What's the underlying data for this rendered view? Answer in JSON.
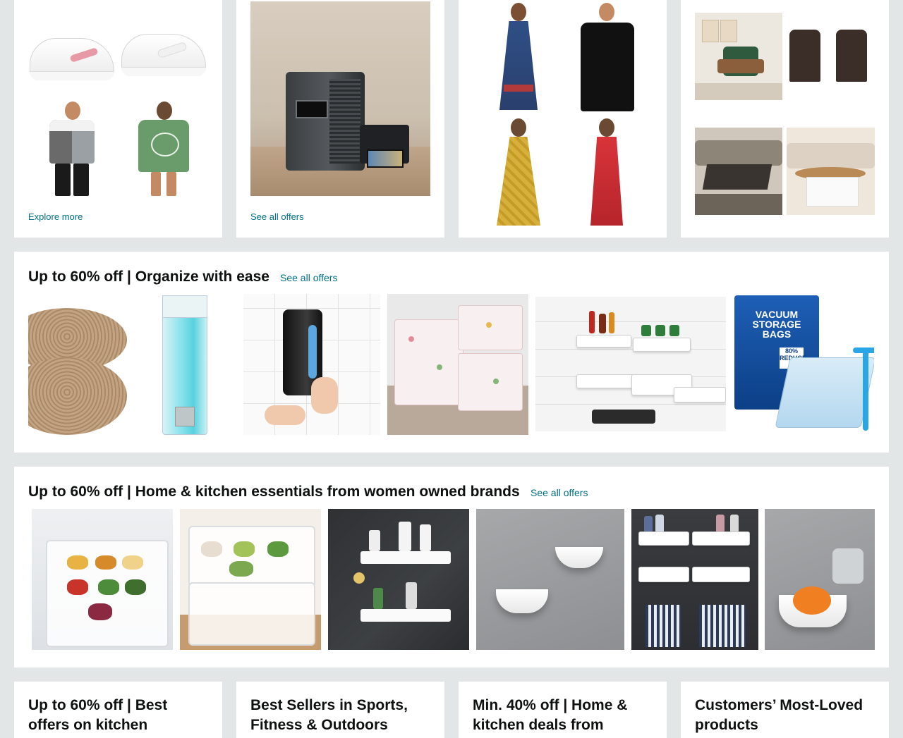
{
  "cards_top": [
    {
      "link": "Explore more"
    },
    {
      "link": "See all offers"
    },
    {
      "link": ""
    },
    {
      "link": ""
    }
  ],
  "organize": {
    "title": "Up to 60% off | Organize with ease",
    "link": "See all offers",
    "vacuum_text": "VACUUM STORAGE BAGS",
    "vacuum_badge": "80% REDUCE"
  },
  "women_brands": {
    "title": "Up to 60% off | Home & kitchen essentials from women owned brands",
    "link": "See all offers"
  },
  "bottom_cards": [
    {
      "title": "Up to 60% off | Best offers on kitchen"
    },
    {
      "title": "Best Sellers in Sports, Fitness & Outdoors"
    },
    {
      "title": "Min. 40% off | Home & kitchen deals from"
    },
    {
      "title": "Customers’ Most-Loved products"
    }
  ],
  "colors": {
    "page_bg": "#e3e6e6",
    "card_bg": "#ffffff",
    "link": "#007185",
    "text": "#0f1111"
  }
}
